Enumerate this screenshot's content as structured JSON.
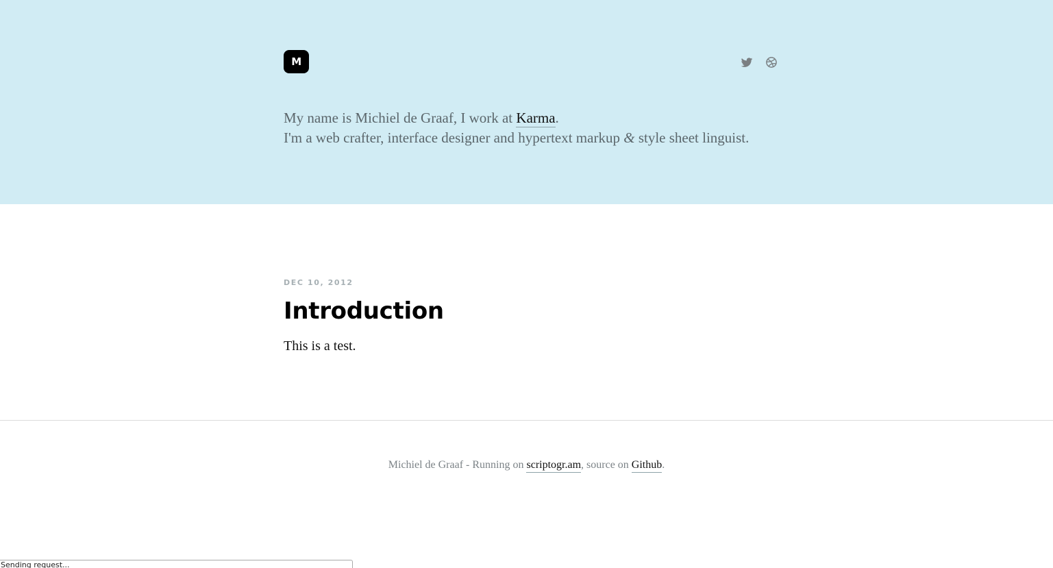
{
  "header": {
    "logo_letter": "M",
    "social": [
      {
        "icon": "twitter-icon",
        "label": "Twitter"
      },
      {
        "icon": "dribbble-icon",
        "label": "Dribbble"
      }
    ],
    "intro": {
      "line1_prefix": "My name is Michiel de Graaf, I work at ",
      "line1_link": "Karma",
      "line1_suffix": ".",
      "line2_prefix": "I'm a web crafter, interface designer and hypertext markup ",
      "line2_amp": "&",
      "line2_suffix": " style sheet linguist."
    }
  },
  "post": {
    "date": "DEC 10, 2012",
    "title": "Introduction",
    "body": "This is a test."
  },
  "footer": {
    "prefix": "Michiel de Graaf - Running on ",
    "link1": "scriptogr.am",
    "middle": ", source on ",
    "link2": "Github",
    "suffix": "."
  },
  "status": {
    "text": "Sending request..."
  },
  "colors": {
    "hero_background": "#d1ecf4",
    "logo_background": "#000000",
    "icon_gray": "#7a7f82",
    "meta_gray": "#a7b0b4",
    "divider": "#dcdcdc"
  }
}
